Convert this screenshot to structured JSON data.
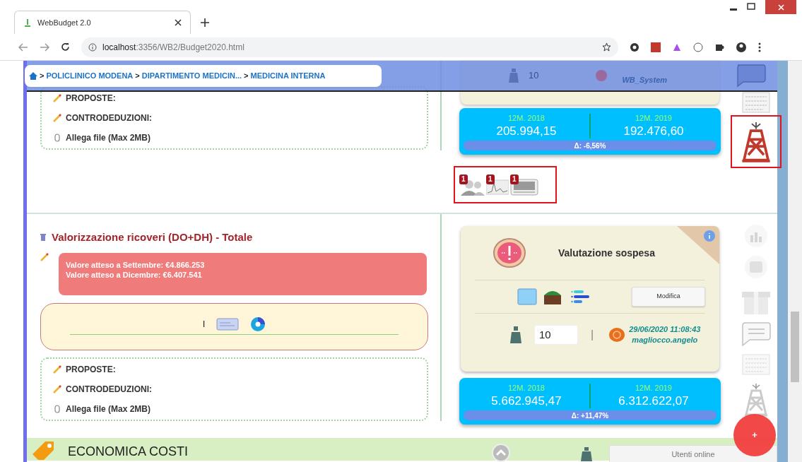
{
  "browser": {
    "tab_title": "WebBudget 2.0",
    "url_host": "localhost",
    "url_path": ":3356/WB2/Budget2020.html"
  },
  "breadcrumb": {
    "separator": ">",
    "items": [
      "POLICLINICO MODENA",
      "DIPARTIMENTO MEDICIN...",
      "MEDICINA INTERNA"
    ]
  },
  "header_overlay": {
    "weight": "10",
    "user": "WB_System"
  },
  "sections": [
    {
      "notes": [
        "PROPOSTE:",
        "CONTRODEDUZIONI:"
      ],
      "attach": "Allega file (Max 2MB)",
      "stats": {
        "label_1": "12M. 2018",
        "value_1": "205.994,15",
        "label_2": "12M. 2019",
        "value_2": "192.476,60",
        "delta": "Δ: -6,56%"
      },
      "badges": [
        {
          "kind": "people",
          "count": "1"
        },
        {
          "kind": "chart",
          "count": "1"
        },
        {
          "kind": "monitor",
          "count": "1"
        }
      ]
    },
    {
      "title": "Valorizzazione ricoveri (DO+DH) - Totale",
      "alert": [
        "Valore atteso a Settembre: €4.866.253",
        "Valore atteso a Dicembre: €6.407.541"
      ],
      "separator": "I",
      "notes": [
        "PROPOSTE:",
        "CONTRODEDUZIONI:"
      ],
      "attach": "Allega file (Max 2MB)",
      "evaluation": {
        "status": "Valutazione sospesa",
        "button": "Modifica",
        "weight": "10",
        "timestamp": "29/06/2020 11:08:43",
        "user": "magliocco.angelo",
        "separator": "|"
      },
      "stats": {
        "label_1": "12M. 2018",
        "value_1": "5.662.945,47",
        "label_2": "12M. 2019",
        "value_2": "6.312.622,07",
        "delta": "Δ: +11,47%"
      }
    }
  ],
  "next_section": {
    "title": "ECONOMICA COSTI"
  },
  "online_panel": {
    "title": "Utenti online"
  },
  "fab": {
    "label": "+"
  }
}
